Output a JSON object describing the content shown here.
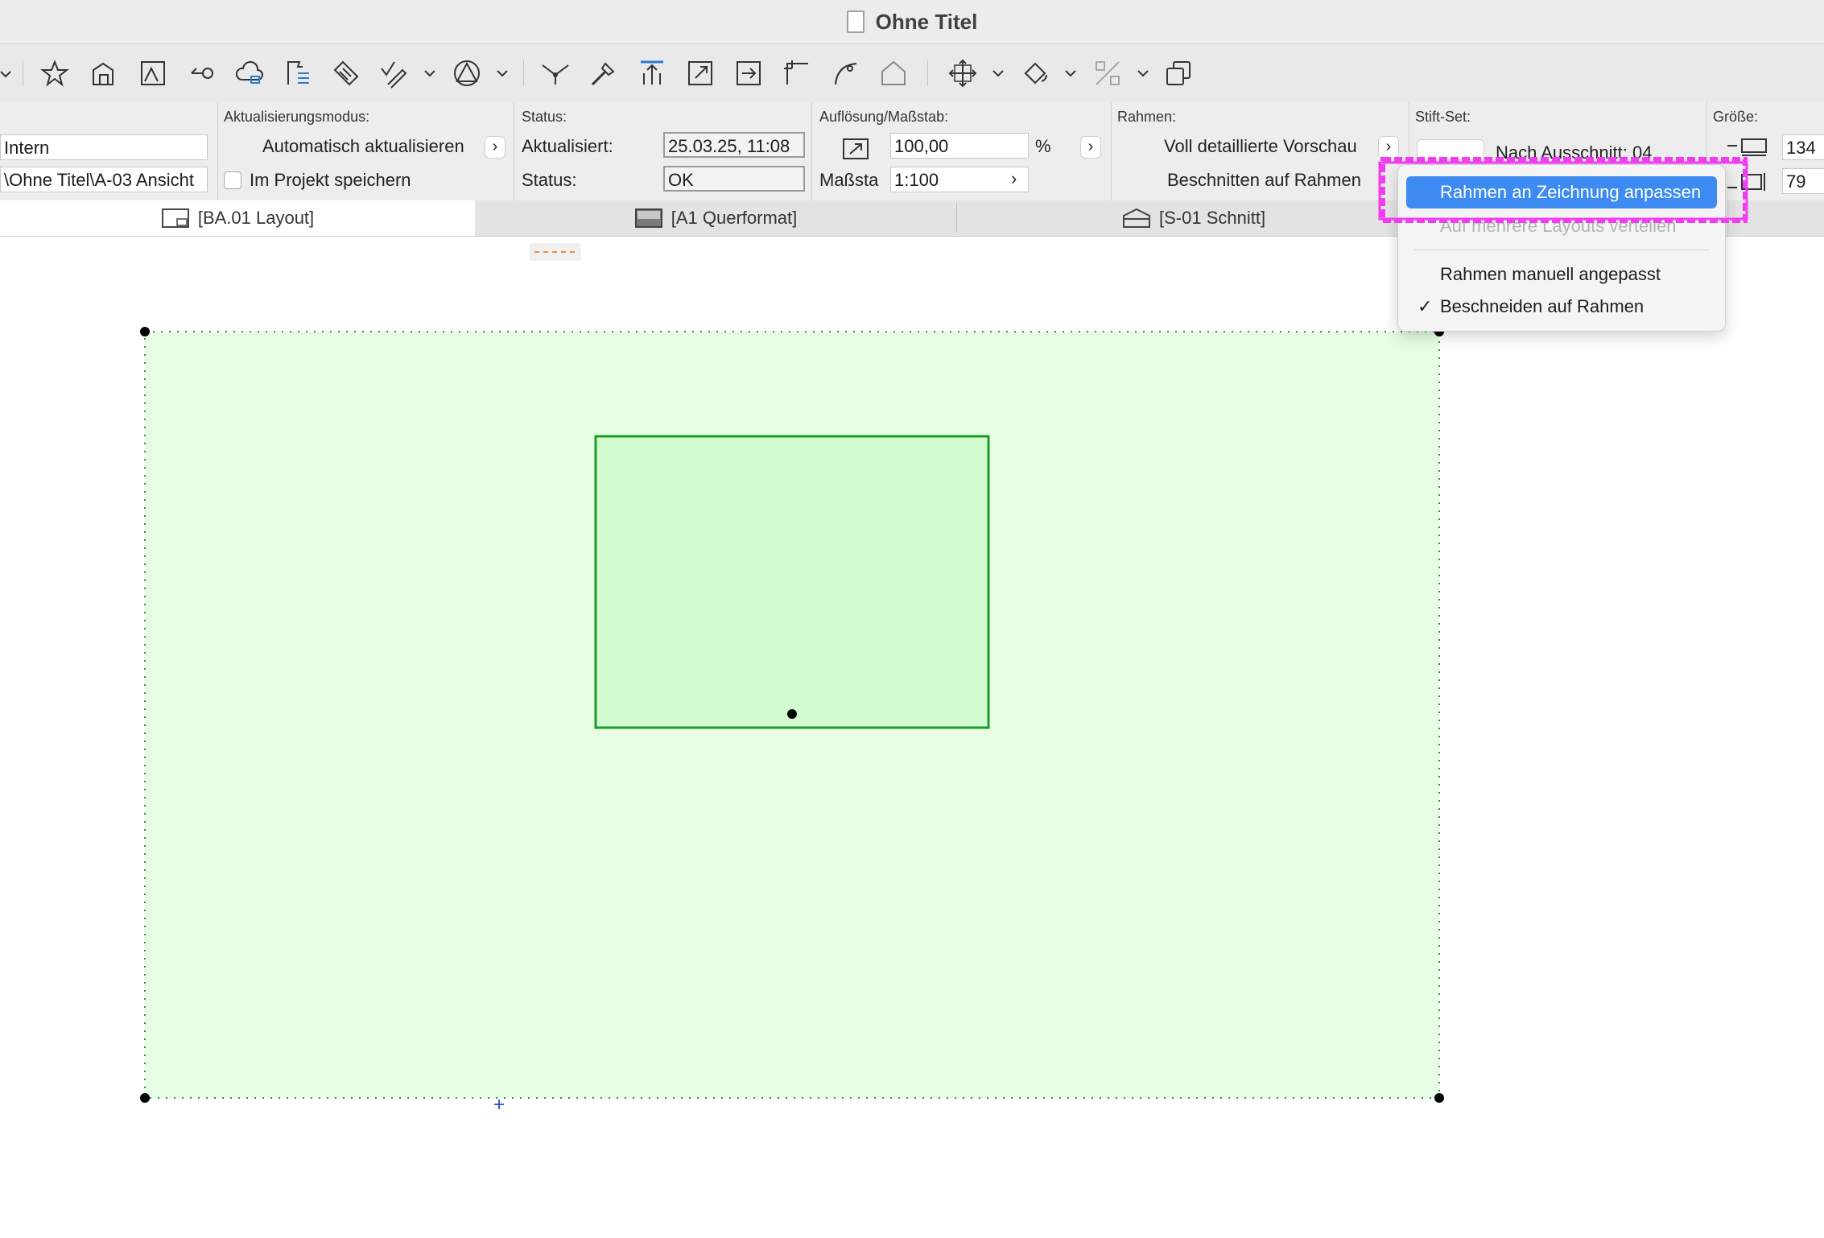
{
  "window": {
    "title": "Ohne Titel"
  },
  "info": {
    "col1": {
      "field1": "Intern",
      "field2": "\\Ohne Titel\\A-03 Ansicht"
    },
    "update": {
      "header": "Aktualisierungsmodus:",
      "mode": "Automatisch aktualisieren",
      "store_label": "Im Projekt speichern"
    },
    "status": {
      "header": "Status:",
      "updated_label": "Aktualisiert:",
      "updated_value": "25.03.25, 11:08",
      "status_label": "Status:",
      "status_value": "OK"
    },
    "resolution": {
      "header": "Auflösung/Maßstab:",
      "value": "100,00",
      "unit": "%",
      "scale_label": "Maßsta",
      "scale_value": "1:100"
    },
    "frame": {
      "header": "Rahmen:",
      "preview": "Voll detaillierte Vorschau",
      "crop": "Beschnitten auf Rahmen"
    },
    "pen": {
      "header": "Stift-Set:",
      "value": "Nach Ausschnitt: 04"
    },
    "size": {
      "header": "Größe:",
      "width": "134",
      "height": "79"
    }
  },
  "tabs": [
    {
      "label": "[BA.01 Layout]"
    },
    {
      "label": "[A1 Querformat]"
    },
    {
      "label": "[S-01 Schnitt]"
    }
  ],
  "menu": {
    "items": [
      {
        "label": "Rahmen an Zeichnung anpassen"
      },
      {
        "label": "Auf mehrere Layouts verteilen"
      },
      {
        "label": "Rahmen manuell angepasst"
      },
      {
        "label": "Beschneiden auf Rahmen",
        "check": "✓"
      }
    ]
  },
  "colors": {
    "frame_fill": "#e6fde3",
    "drawing_fill": "#d2fcd0",
    "drawing_border": "#1f9a2a",
    "highlight": "#3d8bf2",
    "annotation": "#f23cf0"
  }
}
